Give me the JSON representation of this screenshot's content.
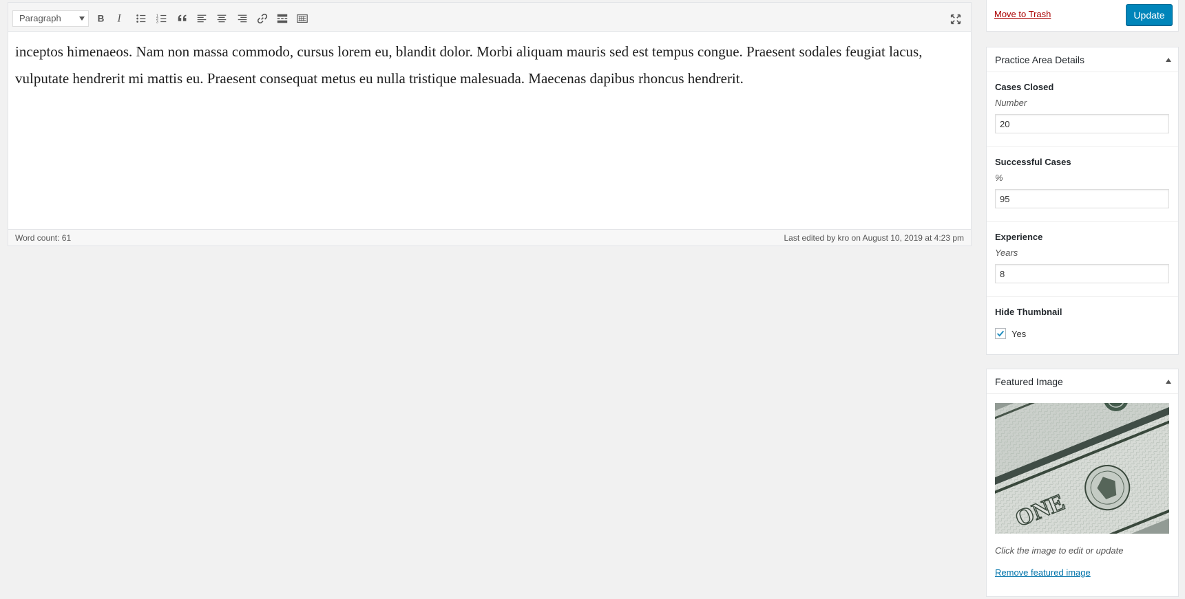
{
  "editor": {
    "format_select": "Paragraph",
    "toolbar_icons": [
      "bold-icon",
      "italic-icon",
      "bulleted-list-icon",
      "numbered-list-icon",
      "blockquote-icon",
      "align-left-icon",
      "align-center-icon",
      "align-right-icon",
      "link-icon",
      "read-more-icon",
      "toolbar-toggle-icon",
      "fullscreen-icon"
    ],
    "content_line_1": "inceptos himenaeos. Nam non massa commodo, cursus lorem eu, blandit dolor. Morbi aliquam mauris sed est tempus congue. Praesent sodales feugiat lacus,",
    "content_line_2": "vulputate hendrerit mi mattis eu. Praesent consequat metus eu nulla tristique malesuada. Maecenas dapibus rhoncus hendrerit.",
    "word_count": "Word count: 61",
    "last_edited": "Last edited by kro on August 10, 2019 at 4:23 pm"
  },
  "publish": {
    "trash_label": "Move to Trash",
    "update_label": "Update"
  },
  "details": {
    "title": "Practice Area Details",
    "fields": [
      {
        "label": "Cases Closed",
        "hint": "Number",
        "value": "20"
      },
      {
        "label": "Successful Cases",
        "hint": "%",
        "value": "95"
      },
      {
        "label": "Experience",
        "hint": "Years",
        "value": "8"
      }
    ],
    "hide_thumbnail": {
      "label": "Hide Thumbnail",
      "option": "Yes",
      "checked": true
    }
  },
  "featured": {
    "title": "Featured Image",
    "image_alt": "US one dollar bill",
    "hint": "Click the image to edit or update",
    "remove_label": "Remove featured image"
  },
  "colors": {
    "accent": "#0085ba",
    "link": "#0073aa",
    "danger": "#a00",
    "background": "#f1f1f1"
  }
}
